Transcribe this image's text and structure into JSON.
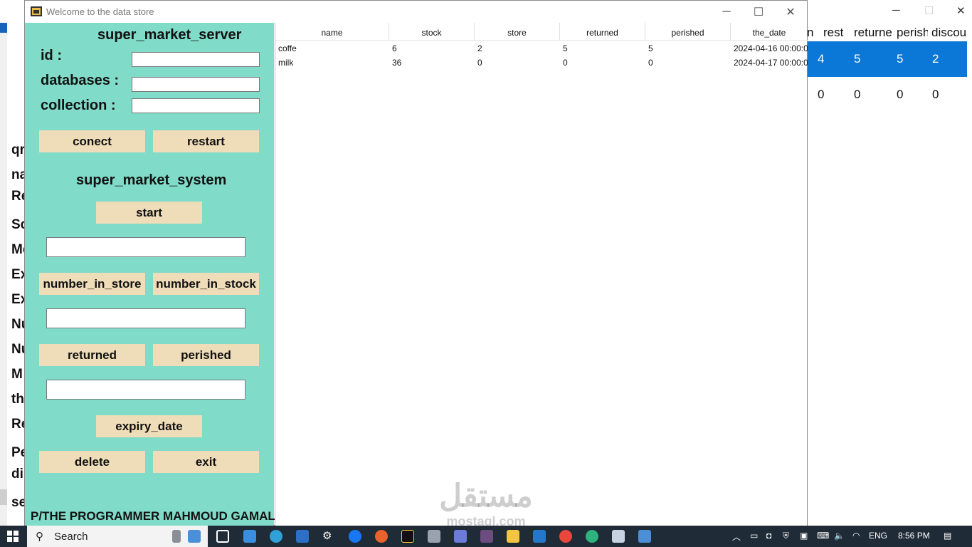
{
  "window": {
    "title": "Welcome to the data store",
    "minimize_glyph": "─",
    "maximize_glyph": "☐",
    "close_glyph": "✕"
  },
  "panel": {
    "server_heading": "super_market_server",
    "id_label": "id :",
    "databases_label": "databases :",
    "collection_label": "collection :",
    "id_value": "",
    "databases_value": "",
    "collection_value": "",
    "connect_button": "conect",
    "restart_button": "restart",
    "system_heading": "super_market_system",
    "start_button": "start",
    "entry1_value": "",
    "number_in_store_button": "number_in_store",
    "number_in_stock_button": "number_in_stock",
    "entry2_value": "",
    "returned_button": "returned",
    "perished_button": "perished",
    "entry3_value": "",
    "expiry_date_button": "expiry_date",
    "delete_button": "delete",
    "exit_button": "exit",
    "footer": "P/THE PROGRAMMER MAHMOUD GAMAL."
  },
  "table": {
    "columns": [
      "name",
      "stock",
      "store",
      "returned",
      "perished",
      "the_date"
    ],
    "rows": [
      [
        "coffe",
        "6",
        "2",
        "5",
        "5",
        "2024-04-16 00:00:00"
      ],
      [
        "milk",
        "36",
        "0",
        "0",
        "0",
        "2024-04-17 00:00:00"
      ]
    ]
  },
  "background_window": {
    "left_labels": [
      "qr",
      "na",
      "Re",
      "Sc",
      "Mc",
      "Ex",
      "Ex",
      "Nu",
      "Nu",
      "M",
      "th",
      "Re",
      "Pe",
      "dis",
      "se"
    ],
    "header_cells": [
      "n",
      "rest",
      "returne",
      "perish",
      "discou"
    ],
    "selected_row": [
      "4",
      "5",
      "5",
      "2"
    ],
    "second_row": [
      "0",
      "0",
      "0",
      "0"
    ],
    "minimize_glyph": "─",
    "maximize_glyph": "☐",
    "close_glyph": "✕"
  },
  "watermark": {
    "arabic": "مستقل",
    "latin": "mostaql.com"
  },
  "taskbar": {
    "search_label": "Search",
    "language": "ENG",
    "time": "8:56 PM"
  },
  "colors": {
    "panel_bg": "#80dbc8",
    "button_bg": "#efdcb8",
    "selection_blue": "#0b78d7",
    "taskbar": "#1f2b37"
  }
}
